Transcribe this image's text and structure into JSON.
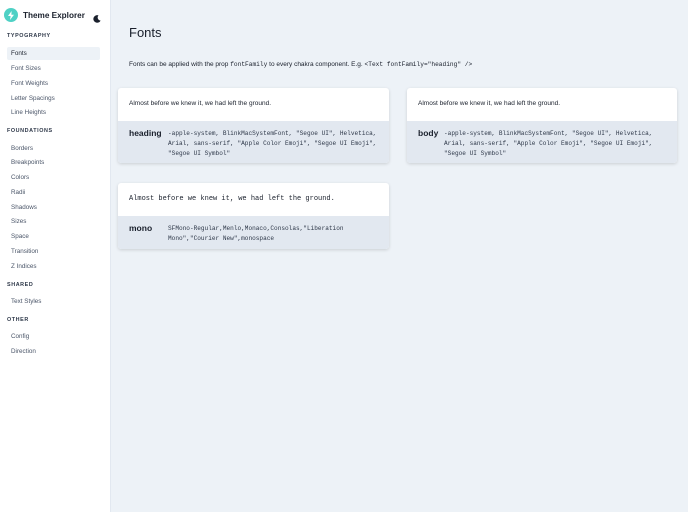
{
  "app": {
    "title": "Theme Explorer"
  },
  "sidebar": {
    "typography": {
      "heading": "Typography",
      "items": [
        "Fonts",
        "Font Sizes",
        "Font Weights",
        "Letter Spacings",
        "Line Heights"
      ]
    },
    "foundations": {
      "heading": "Foundations",
      "items": [
        "Borders",
        "Breakpoints",
        "Colors",
        "Radii",
        "Shadows",
        "Sizes",
        "Space",
        "Transition",
        "Z Indices"
      ]
    },
    "shared": {
      "heading": "Shared",
      "items": [
        "Text Styles"
      ]
    },
    "other": {
      "heading": "Other",
      "items": [
        "Config",
        "Direction"
      ]
    },
    "active": "Fonts"
  },
  "main": {
    "title": "Fonts",
    "intro": {
      "text1": "Fonts can be applied with the prop",
      "code1": "fontFamily",
      "text2": "to every chakra component. E.g.",
      "code2": "<Text fontFamily=\"heading\" />"
    },
    "cards": [
      {
        "sample": "Almost before we knew it, we had left the ground.",
        "name": "heading",
        "value": "-apple-system, BlinkMacSystemFont, \"Segoe UI\", Helvetica, Arial, sans-serif, \"Apple Color Emoji\", \"Segoe UI Emoji\", \"Segoe UI Symbol\""
      },
      {
        "sample": "Almost before we knew it, we had left the ground.",
        "name": "body",
        "value": "-apple-system, BlinkMacSystemFont, \"Segoe UI\", Helvetica, Arial, sans-serif, \"Apple Color Emoji\", \"Segoe UI Emoji\", \"Segoe UI Symbol\""
      },
      {
        "sample": "Almost before we knew it, we had left the ground.",
        "name": "mono",
        "value": "SFMono-Regular,Menlo,Monaco,Consolas,\"Liberation Mono\",\"Courier New\",monospace"
      }
    ]
  },
  "icons": {
    "logo": "lightning-bolt-icon",
    "theme_toggle": "moon-icon"
  },
  "colors": {
    "accent": "#4fd1c5",
    "page_bg": "#edf2f7",
    "card_footer": "#e2e8f0"
  }
}
